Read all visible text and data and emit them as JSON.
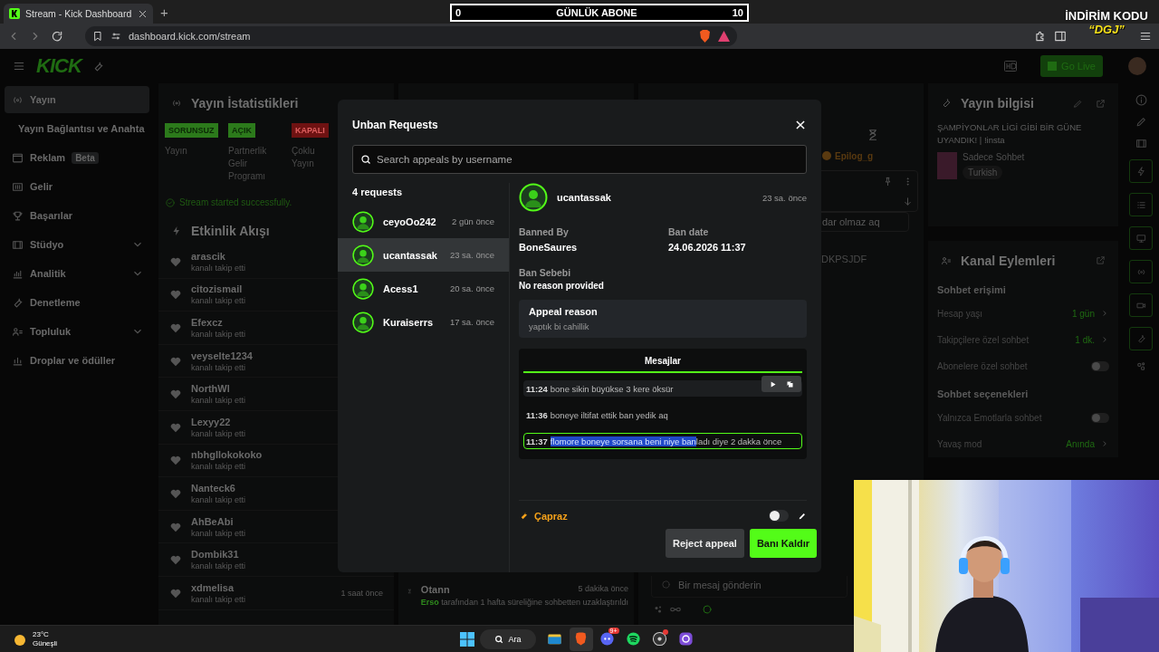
{
  "browser": {
    "tab_title": "Stream - Kick Dashboard",
    "new_tab": "+",
    "url": "dashboard.kick.com/stream"
  },
  "stream_overlay": {
    "goal": {
      "current": "0",
      "label": "GÜNLÜK ABONE",
      "target": "10"
    },
    "promo": {
      "title": "İNDİRİM KODU",
      "code": "“DGJ”"
    }
  },
  "header": {
    "logo": "KICK",
    "go_live": "Go Live"
  },
  "sidebar": {
    "items": [
      {
        "label": "Yayın",
        "selected": true,
        "has_submenu": false
      },
      {
        "label": "Yayın Bağlantısı ve Anahta",
        "selected": false,
        "has_submenu": false
      },
      {
        "label": "Reklam",
        "badge": "Beta",
        "selected": false,
        "has_submenu": false
      },
      {
        "label": "Gelir",
        "selected": false,
        "has_submenu": false
      },
      {
        "label": "Başarılar",
        "selected": false,
        "has_submenu": false
      },
      {
        "label": "Stüdyo",
        "selected": false,
        "has_submenu": true
      },
      {
        "label": "Analitik",
        "selected": false,
        "has_submenu": true
      },
      {
        "label": "Denetleme",
        "selected": false,
        "has_submenu": false
      },
      {
        "label": "Topluluk",
        "selected": false,
        "has_submenu": true
      },
      {
        "label": "Droplar ve ödüller",
        "selected": false,
        "has_submenu": false
      }
    ]
  },
  "stats": {
    "title": "Yayın İstatistikleri",
    "items": [
      {
        "status": "SORUNSUZ",
        "color": "#2c7a1b",
        "label": "Yayın"
      },
      {
        "status": "AÇIK",
        "color": "#2c7a1b",
        "label": "Partnerlik Gelir Programı"
      },
      {
        "status": "KAPALI",
        "color": "#6e1212",
        "label": "Çoklu Yayın"
      }
    ],
    "notice": "Stream started successfully."
  },
  "activity": {
    "title": "Etkinlik Akışı",
    "events": [
      {
        "user": "arascik",
        "action": "kanalı takip etti"
      },
      {
        "user": "citozismail",
        "action": "kanalı takip etti"
      },
      {
        "user": "Efexcz",
        "action": "kanalı takip etti"
      },
      {
        "user": "veyselte1234",
        "action": "kanalı takip etti"
      },
      {
        "user": "NorthWl",
        "action": "kanalı takip etti"
      },
      {
        "user": "Lexyy22",
        "action": "kanalı takip etti"
      },
      {
        "user": "nbhgllokokoko",
        "action": "kanalı takip etti"
      },
      {
        "user": "Nanteck6",
        "action": "kanalı takip etti"
      },
      {
        "user": "AhBeAbi",
        "action": "kanalı takip etti"
      },
      {
        "user": "Dombik31",
        "action": "kanalı takip etti"
      },
      {
        "user": "xdmelisa",
        "action": "kanalı takip etti",
        "time": "1 saat önce"
      }
    ]
  },
  "moderation_feed": {
    "events": [
      {
        "user": "Otann",
        "time": "5 dakika önce",
        "moderator": "Erso",
        "action": "tarafından 1 hafta süreliğine sohbetten uzaklaştırıldı"
      }
    ]
  },
  "chat": {
    "pinned_user": "Epilog_g",
    "messages": [
      "dar olmaz aq",
      "DKPSJDF"
    ],
    "input_placeholder": "Bir mesaj gönderin"
  },
  "stream_info": {
    "title": "Yayın bilgisi",
    "stream_title": "ŞAMPİYONLAR LİGİ GİBİ BİR GÜNE UYANDIK! | !insta",
    "category": "Sadece Sohbet",
    "tags": [
      "Turkish"
    ]
  },
  "channel_actions": {
    "title": "Kanal Eylemleri",
    "sections": [
      {
        "heading": "Sohbet erişimi",
        "rows": [
          {
            "kind": "link",
            "label": "Hesap yaşı",
            "value": "1 gün"
          },
          {
            "kind": "link",
            "label": "Takipçilere özel sohbet",
            "value": "1 dk."
          },
          {
            "kind": "toggle",
            "label": "Abonelere özel sohbet",
            "on": false
          }
        ]
      },
      {
        "heading": "Sohbet seçenekleri",
        "rows": [
          {
            "kind": "toggle",
            "label": "Yalnızca Emotlarla sohbet",
            "on": false
          },
          {
            "kind": "link",
            "label": "Yavaş mod",
            "value": "Anında"
          }
        ]
      }
    ]
  },
  "unban_modal": {
    "title": "Unban Requests",
    "search_placeholder": "Search appeals by username",
    "count": "4 requests",
    "requests": [
      {
        "user": "ceyoOo242",
        "time": "2 gün önce",
        "selected": false
      },
      {
        "user": "ucantassak",
        "time": "23 sa. önce",
        "selected": true
      },
      {
        "user": "Acess1",
        "time": "20 sa. önce",
        "selected": false
      },
      {
        "user": "Kuraiserrs",
        "time": "17 sa. önce",
        "selected": false
      }
    ],
    "detail": {
      "user": "ucantassak",
      "time": "23 sa. önce",
      "fields": [
        {
          "label": "Banned By",
          "value": "BoneSaures"
        },
        {
          "label": "Ban date",
          "value": "24.06.2026 11:37"
        },
        {
          "label": "Ban Sebebi",
          "value": "No reason provided"
        }
      ],
      "appeal": {
        "label": "Appeal reason",
        "text": "yaptık bi cahillik"
      },
      "messages_tab": "Mesajlar",
      "messages": [
        {
          "time": "11:24",
          "text": "bone sikin büyükse 3 kere öksür",
          "hovered": true,
          "highlighted": false
        },
        {
          "time": "11:36",
          "text": "boneye iltifat ettik ban yedik aq",
          "hovered": false,
          "highlighted": false
        },
        {
          "time": "11:37",
          "selected_text": "flomore boneye sorsana beni niye ban",
          "text": "ladı diye 2 dakka önce",
          "hovered": false,
          "highlighted": true
        }
      ]
    },
    "moderator": {
      "name": "Çapraz",
      "toggle_on": false
    },
    "reject": "Reject appeal",
    "accept": "Banı Kaldır"
  },
  "taskbar": {
    "weather": {
      "temp": "23°C",
      "condition": "Güneşli"
    },
    "search": "Ara",
    "apps": [
      {
        "active": false
      },
      {
        "active": true
      },
      {
        "active": false,
        "badge": "9+"
      },
      {
        "active": false
      },
      {
        "active": false,
        "alert": true
      },
      {
        "active": false
      }
    ]
  }
}
